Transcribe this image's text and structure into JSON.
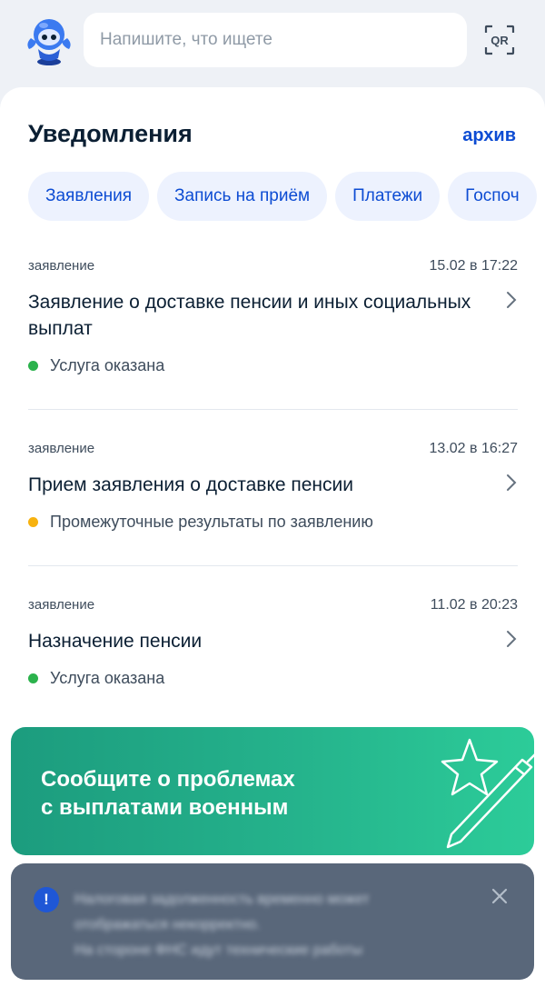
{
  "search": {
    "placeholder": "Напишите, что ищете",
    "qr_label": "QR"
  },
  "header": {
    "title": "Уведомления",
    "archive_link": "архив"
  },
  "filters": [
    "Заявления",
    "Запись на приём",
    "Платежи",
    "Госпоч"
  ],
  "notifications": [
    {
      "kind": "заявление",
      "date": "15.02 в 17:22",
      "title": "Заявление о доставке пенсии и иных социальных выплат",
      "status": "Услуга оказана",
      "status_color": "#2bb24c"
    },
    {
      "kind": "заявление",
      "date": "13.02 в 16:27",
      "title": "Прием заявления о доставке пенсии",
      "status": "Промежуточные результаты по заявлению",
      "status_color": "#f7b20f"
    },
    {
      "kind": "заявление",
      "date": "11.02 в 20:23",
      "title": "Назначение пенсии",
      "status": "Услуга оказана",
      "status_color": "#2bb24c"
    }
  ],
  "banner": {
    "line1": "Сообщите о проблемах",
    "line2": "с выплатами военным"
  },
  "toast": {
    "line1": "Налоговая задолженность временно может",
    "line2": "отображаться некорректно.",
    "line3": "На стороне ФНС идут технические работы"
  },
  "colors": {
    "accent": "#0d4cd3",
    "banner_start": "#1c9c7e",
    "banner_end": "#2ccc99",
    "toast_bg": "#59677a"
  }
}
